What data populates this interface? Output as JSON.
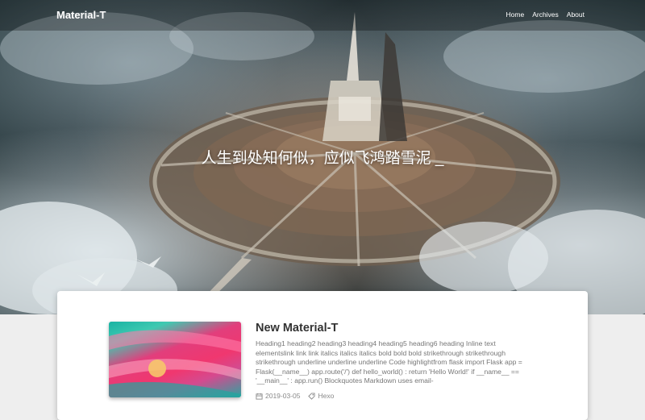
{
  "navbar": {
    "brand": "Material-T",
    "links": [
      "Home",
      "Archives",
      "About"
    ]
  },
  "hero": {
    "slogan": "人生到处知何似，应似飞鸿踏雪泥 _"
  },
  "post": {
    "title": "New Material-T",
    "excerpt": "Heading1 heading2 heading3 heading4 heading5 heading6 heading Inline text elementslink link link italics italics italics bold bold bold strikethrough strikethrough strikethrough underline underline underline Code highlightfrom flask import Flask app = Flask(__name__) app.route('/') def hello_world() : return 'Hello World!' if __name__ == '__main__' : app.run() Blockquotes Markdown uses email-",
    "date": "2019-03-05",
    "tag": "Hexo"
  },
  "icons": {
    "calendar": "calendar-icon",
    "tag": "tag-icon"
  },
  "colors": {
    "title_text": "#333333",
    "excerpt_text": "#777777",
    "page_bg": "#eeeeee"
  }
}
